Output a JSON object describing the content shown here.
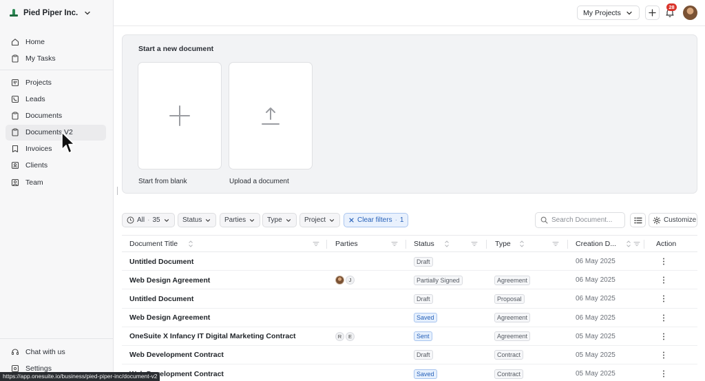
{
  "org": {
    "name": "Pied Piper Inc."
  },
  "sidebar": {
    "top_items": [
      {
        "label": "Home",
        "icon": "home-icon"
      },
      {
        "label": "My Tasks",
        "icon": "clipboard-icon"
      }
    ],
    "main_items": [
      {
        "label": "Projects",
        "icon": "kanban-icon"
      },
      {
        "label": "Leads",
        "icon": "phone-icon"
      },
      {
        "label": "Documents",
        "icon": "clipboard-icon"
      },
      {
        "label": "Documents V2",
        "icon": "clipboard-icon",
        "active": true
      },
      {
        "label": "Invoices",
        "icon": "bookmark-icon"
      },
      {
        "label": "Clients",
        "icon": "contacts-icon"
      },
      {
        "label": "Team",
        "icon": "user-square-icon"
      }
    ],
    "bottom_items": [
      {
        "label": "Chat with us",
        "icon": "headset-icon"
      },
      {
        "label": "Settings",
        "icon": "gear-icon"
      }
    ]
  },
  "topbar": {
    "projects_label": "My Projects",
    "notification_count": "28"
  },
  "start": {
    "title": "Start a new document",
    "blank_label": "Start from blank",
    "upload_label": "Upload a document"
  },
  "filters": {
    "all_label": "All",
    "all_count": "35",
    "status_label": "Status",
    "parties_label": "Parties",
    "type_label": "Type",
    "project_label": "Project",
    "clear_label": "Clear filters",
    "clear_count": "1",
    "search_placeholder": "Search Document...",
    "customize_label": "Customize"
  },
  "table": {
    "columns": {
      "title": "Document Title",
      "parties": "Parties",
      "status": "Status",
      "type": "Type",
      "created": "Creation D...",
      "action": "Action"
    },
    "rows": [
      {
        "title": "Untitled Document",
        "parties": [],
        "status": "Draft",
        "status_kind": "draft",
        "type": "",
        "date": "06 May 2025"
      },
      {
        "title": "Web Design Agreement",
        "parties": [
          "photo",
          "J"
        ],
        "status": "Partially Signed",
        "status_kind": "draft",
        "type": "Agreement",
        "date": "06 May 2025"
      },
      {
        "title": "Untitled Document",
        "parties": [],
        "status": "Draft",
        "status_kind": "draft",
        "type": "Proposal",
        "date": "06 May 2025"
      },
      {
        "title": "Web Design Agreement",
        "parties": [],
        "status": "Saved",
        "status_kind": "saved",
        "type": "Agreement",
        "date": "06 May 2025"
      },
      {
        "title": "OneSuite X Infancy IT Digital Marketing Contract",
        "parties": [
          "R",
          "E"
        ],
        "status": "Sent",
        "status_kind": "sent",
        "type": "Agreement",
        "date": "05 May 2025"
      },
      {
        "title": "Web Development Contract",
        "parties": [],
        "status": "Draft",
        "status_kind": "draft",
        "type": "Contract",
        "date": "05 May 2025"
      },
      {
        "title": "Web Development Contract",
        "parties": [],
        "status": "Saved",
        "status_kind": "saved",
        "type": "Contract",
        "date": "05 May 2025"
      }
    ]
  },
  "status_bar_url": "https://app.onesuite.io/business/pied-piper-inc/document-v2"
}
